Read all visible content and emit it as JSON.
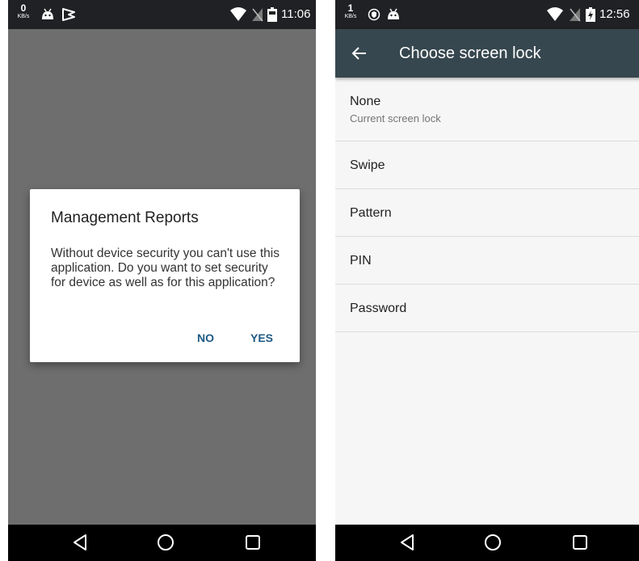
{
  "left_screen": {
    "status_bar": {
      "net_speed_value": "0",
      "net_speed_unit": "KB/s",
      "icons": [
        "android-icon",
        "play-flag-icon",
        "wifi-icon",
        "no-sim-icon",
        "battery-icon"
      ],
      "time": "11:06"
    },
    "dialog": {
      "title": "Management Reports",
      "message": "Without device security you can't use this application. Do you want to set security for device as well as for this application?",
      "no_label": "NO",
      "yes_label": "YES"
    },
    "nav_bar": {
      "icons": [
        "back-triangle-icon",
        "home-circle-icon",
        "recents-square-icon"
      ]
    }
  },
  "right_screen": {
    "status_bar": {
      "net_speed_value": "1",
      "net_speed_unit": "KB/s",
      "icons": [
        "shield-icon",
        "android-icon",
        "wifi-icon",
        "no-sim-icon",
        "battery-charging-icon"
      ],
      "time": "12:56"
    },
    "app_bar": {
      "title": "Choose screen lock",
      "back_icon": "arrow-left-icon"
    },
    "lock_options": [
      {
        "label": "None",
        "summary": "Current screen lock"
      },
      {
        "label": "Swipe"
      },
      {
        "label": "Pattern"
      },
      {
        "label": "PIN"
      },
      {
        "label": "Password"
      }
    ],
    "nav_bar": {
      "icons": [
        "back-triangle-icon",
        "home-circle-icon",
        "recents-square-icon"
      ]
    }
  },
  "colors": {
    "status_bar": "#202124",
    "scrim": "#6e6e6e",
    "dialog_button": "#1f5a85",
    "app_bar": "#37474f",
    "list_background": "#f6f6f6",
    "nav_bar": "#000000"
  }
}
